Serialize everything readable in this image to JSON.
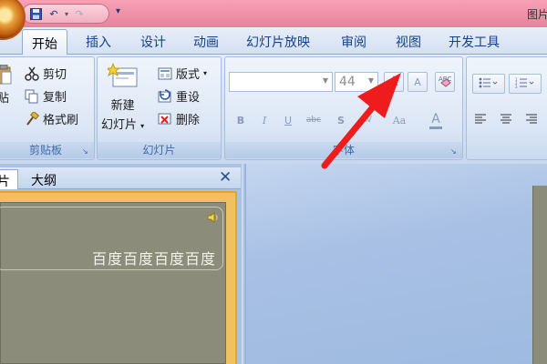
{
  "window": {
    "title": "图片"
  },
  "tabs": [
    "开始",
    "插入",
    "设计",
    "动画",
    "幻灯片放映",
    "审阅",
    "视图",
    "开发工具"
  ],
  "clipboard": {
    "paste_partial": "贴",
    "cut": "剪切",
    "copy": "复制",
    "format_painter": "格式刷",
    "label": "剪贴板"
  },
  "slides_group": {
    "new_slide_line1": "新建",
    "new_slide_line2": "幻灯片",
    "layout": "版式",
    "reset": "重设",
    "delete": "删除",
    "label": "幻灯片"
  },
  "font_group": {
    "font_name": "",
    "font_size": "44",
    "grow_font": "A",
    "shrink_font": "A",
    "bold": "B",
    "italic": "I",
    "underline": "U",
    "strike": "abc",
    "shadow": "S",
    "spacing": "AV",
    "change_case": "Aa",
    "font_color": "A",
    "label": "字体"
  },
  "pane": {
    "slides_tab_partial": "片",
    "outline_tab": "大纲",
    "close": "✕"
  },
  "thumbnail": {
    "text": "百度百度百度百度"
  }
}
